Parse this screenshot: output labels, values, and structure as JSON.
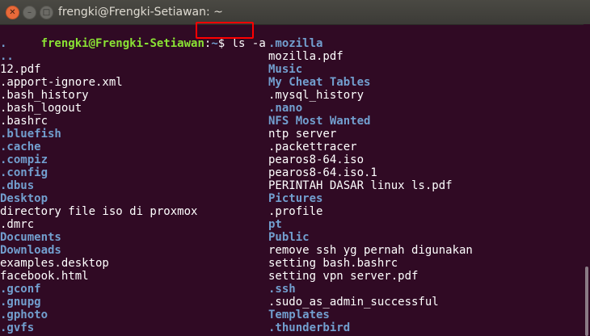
{
  "window": {
    "title": "frengki@Frengki-Setiawan: ~"
  },
  "prompt": {
    "user_host": "frengki@Frengki-Setiawan",
    "sep": ":",
    "path": "~",
    "dollar": "$",
    "command": " ls -a"
  },
  "left_column": [
    {
      "name": ".",
      "type": "dir"
    },
    {
      "name": "..",
      "type": "dir"
    },
    {
      "name": "12.pdf",
      "type": "file"
    },
    {
      "name": ".apport-ignore.xml",
      "type": "file"
    },
    {
      "name": ".bash_history",
      "type": "file"
    },
    {
      "name": ".bash_logout",
      "type": "file"
    },
    {
      "name": ".bashrc",
      "type": "file"
    },
    {
      "name": ".bluefish",
      "type": "dir"
    },
    {
      "name": ".cache",
      "type": "dir"
    },
    {
      "name": ".compiz",
      "type": "dir"
    },
    {
      "name": ".config",
      "type": "dir"
    },
    {
      "name": ".dbus",
      "type": "dir"
    },
    {
      "name": "Desktop",
      "type": "dir"
    },
    {
      "name": "directory file iso di proxmox",
      "type": "file"
    },
    {
      "name": ".dmrc",
      "type": "file"
    },
    {
      "name": "Documents",
      "type": "dir"
    },
    {
      "name": "Downloads",
      "type": "dir"
    },
    {
      "name": "examples.desktop",
      "type": "file"
    },
    {
      "name": "facebook.html",
      "type": "file"
    },
    {
      "name": ".gconf",
      "type": "dir"
    },
    {
      "name": ".gnupg",
      "type": "dir"
    },
    {
      "name": ".gphoto",
      "type": "dir"
    },
    {
      "name": ".gvfs",
      "type": "dir"
    }
  ],
  "right_column": [
    {
      "name": ".mozilla",
      "type": "dir"
    },
    {
      "name": "mozilla.pdf",
      "type": "file"
    },
    {
      "name": "Music",
      "type": "dir"
    },
    {
      "name": "My Cheat Tables",
      "type": "dir"
    },
    {
      "name": ".mysql_history",
      "type": "file"
    },
    {
      "name": ".nano",
      "type": "dir"
    },
    {
      "name": "NFS Most Wanted",
      "type": "dir"
    },
    {
      "name": "ntp server",
      "type": "file"
    },
    {
      "name": ".packettracer",
      "type": "file"
    },
    {
      "name": "pearos8-64.iso",
      "type": "file"
    },
    {
      "name": "pearos8-64.iso.1",
      "type": "file"
    },
    {
      "name": "PERINTAH DASAR linux ls.pdf",
      "type": "file"
    },
    {
      "name": "Pictures",
      "type": "dir"
    },
    {
      "name": ".profile",
      "type": "file"
    },
    {
      "name": "pt",
      "type": "dir"
    },
    {
      "name": "Public",
      "type": "dir"
    },
    {
      "name": "remove ssh yg pernah digunakan",
      "type": "file"
    },
    {
      "name": "setting bash.bashrc",
      "type": "file"
    },
    {
      "name": "setting vpn server.pdf",
      "type": "file"
    },
    {
      "name": ".ssh",
      "type": "dir"
    },
    {
      "name": ".sudo_as_admin_successful",
      "type": "file"
    },
    {
      "name": "Templates",
      "type": "dir"
    },
    {
      "name": ".thunderbird",
      "type": "dir"
    }
  ],
  "colors": {
    "background": "#300a24",
    "user": "#8ae234",
    "directory": "#729fcf",
    "file": "#ffffff",
    "highlight": "#ff0000"
  }
}
